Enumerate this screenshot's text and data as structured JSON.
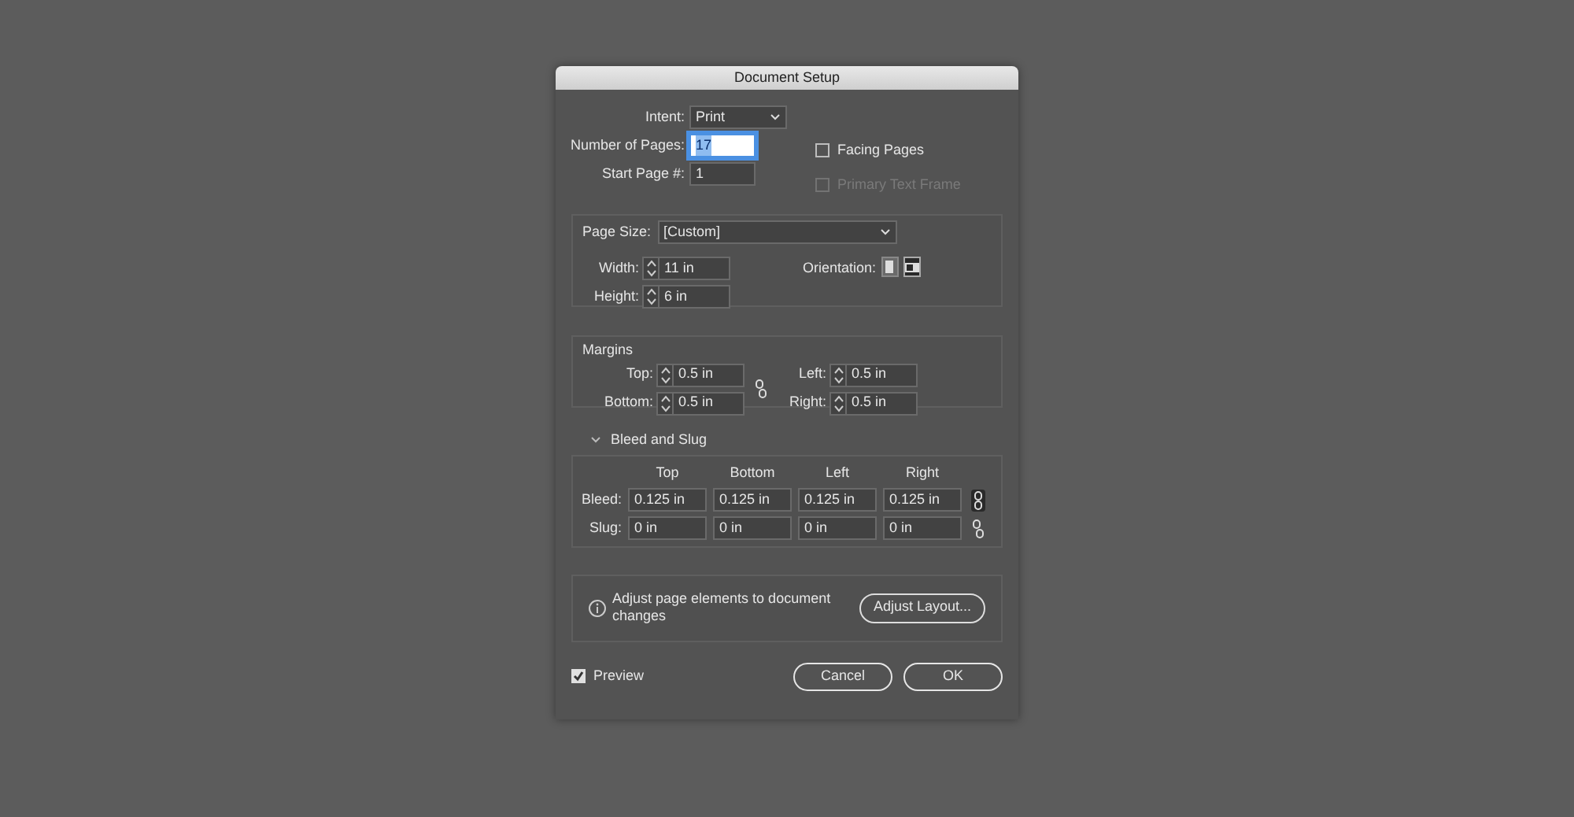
{
  "window": {
    "title": "Document Setup"
  },
  "intent": {
    "label": "Intent:",
    "value": "Print"
  },
  "number_of_pages": {
    "label": "Number of Pages:",
    "value": "17",
    "focused": true
  },
  "start_page": {
    "label": "Start Page #:",
    "value": "1"
  },
  "facing_pages": {
    "label": "Facing Pages",
    "checked": false,
    "disabled": false
  },
  "primary_text_frame": {
    "label": "Primary Text Frame",
    "checked": false,
    "disabled": true
  },
  "page_size": {
    "label": "Page Size:",
    "value": "[Custom]"
  },
  "width": {
    "label": "Width:",
    "value": "11 in"
  },
  "height": {
    "label": "Height:",
    "value": "6 in"
  },
  "orientation": {
    "label": "Orientation:",
    "options": [
      {
        "kind": "portrait",
        "selected": false
      },
      {
        "kind": "landscape",
        "selected": true
      }
    ]
  },
  "margins": {
    "title": "Margins",
    "linked": false,
    "fields": [
      {
        "label": "Top:",
        "value": "0.5 in"
      },
      {
        "label": "Left:",
        "value": "0.5 in"
      },
      {
        "label": "Bottom:",
        "value": "0.5 in"
      },
      {
        "label": "Right:",
        "value": "0.5 in"
      }
    ]
  },
  "bleed_and_slug": {
    "title": "Bleed and Slug",
    "expanded": true,
    "columns": [
      "Top",
      "Bottom",
      "Left",
      "Right"
    ],
    "rows": [
      {
        "label": "Bleed:",
        "values": [
          "0.125 in",
          "0.125 in",
          "0.125 in",
          "0.125 in"
        ],
        "linked": true
      },
      {
        "label": "Slug:",
        "values": [
          "0 in",
          "0 in",
          "0 in",
          "0 in"
        ],
        "linked": false
      }
    ]
  },
  "info": {
    "text": "Adjust page elements to document changes",
    "button": "Adjust Layout..."
  },
  "preview": {
    "label": "Preview",
    "checked": true
  },
  "buttons": [
    "Cancel",
    "OK"
  ]
}
